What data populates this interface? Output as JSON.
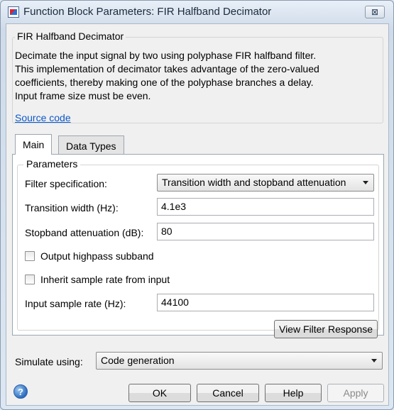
{
  "window": {
    "title": "Function Block Parameters: FIR Halfband Decimator",
    "close_glyph": "⊠"
  },
  "block": {
    "name": "FIR Halfband Decimator",
    "description_lines": [
      "Decimate the input signal by two using polyphase FIR halfband filter.",
      "This implementation of decimator takes advantage of the zero-valued",
      "coefficients, thereby making one of the polyphase branches a delay.",
      "Input frame size must be even."
    ],
    "source_link": "Source code"
  },
  "tabs": [
    {
      "label": "Main",
      "active": true
    },
    {
      "label": "Data Types",
      "active": false
    }
  ],
  "parameters": {
    "group_label": "Parameters",
    "filter_spec_label": "Filter specification:",
    "filter_spec_value": "Transition width and stopband attenuation",
    "transition_width_label": "Transition width (Hz):",
    "transition_width_value": "4.1e3",
    "stopband_label": "Stopband attenuation (dB):",
    "stopband_value": "80",
    "output_highpass_label": "Output highpass subband",
    "output_highpass_checked": false,
    "inherit_rate_label": "Inherit sample rate from input",
    "inherit_rate_checked": false,
    "input_rate_label": "Input sample rate (Hz):",
    "input_rate_value": "44100",
    "view_response_label": "View Filter Response"
  },
  "simulate": {
    "label": "Simulate using:",
    "value": "Code generation"
  },
  "buttons": {
    "help_icon": "question-mark",
    "ok": "OK",
    "cancel": "Cancel",
    "help": "Help",
    "apply": "Apply"
  }
}
